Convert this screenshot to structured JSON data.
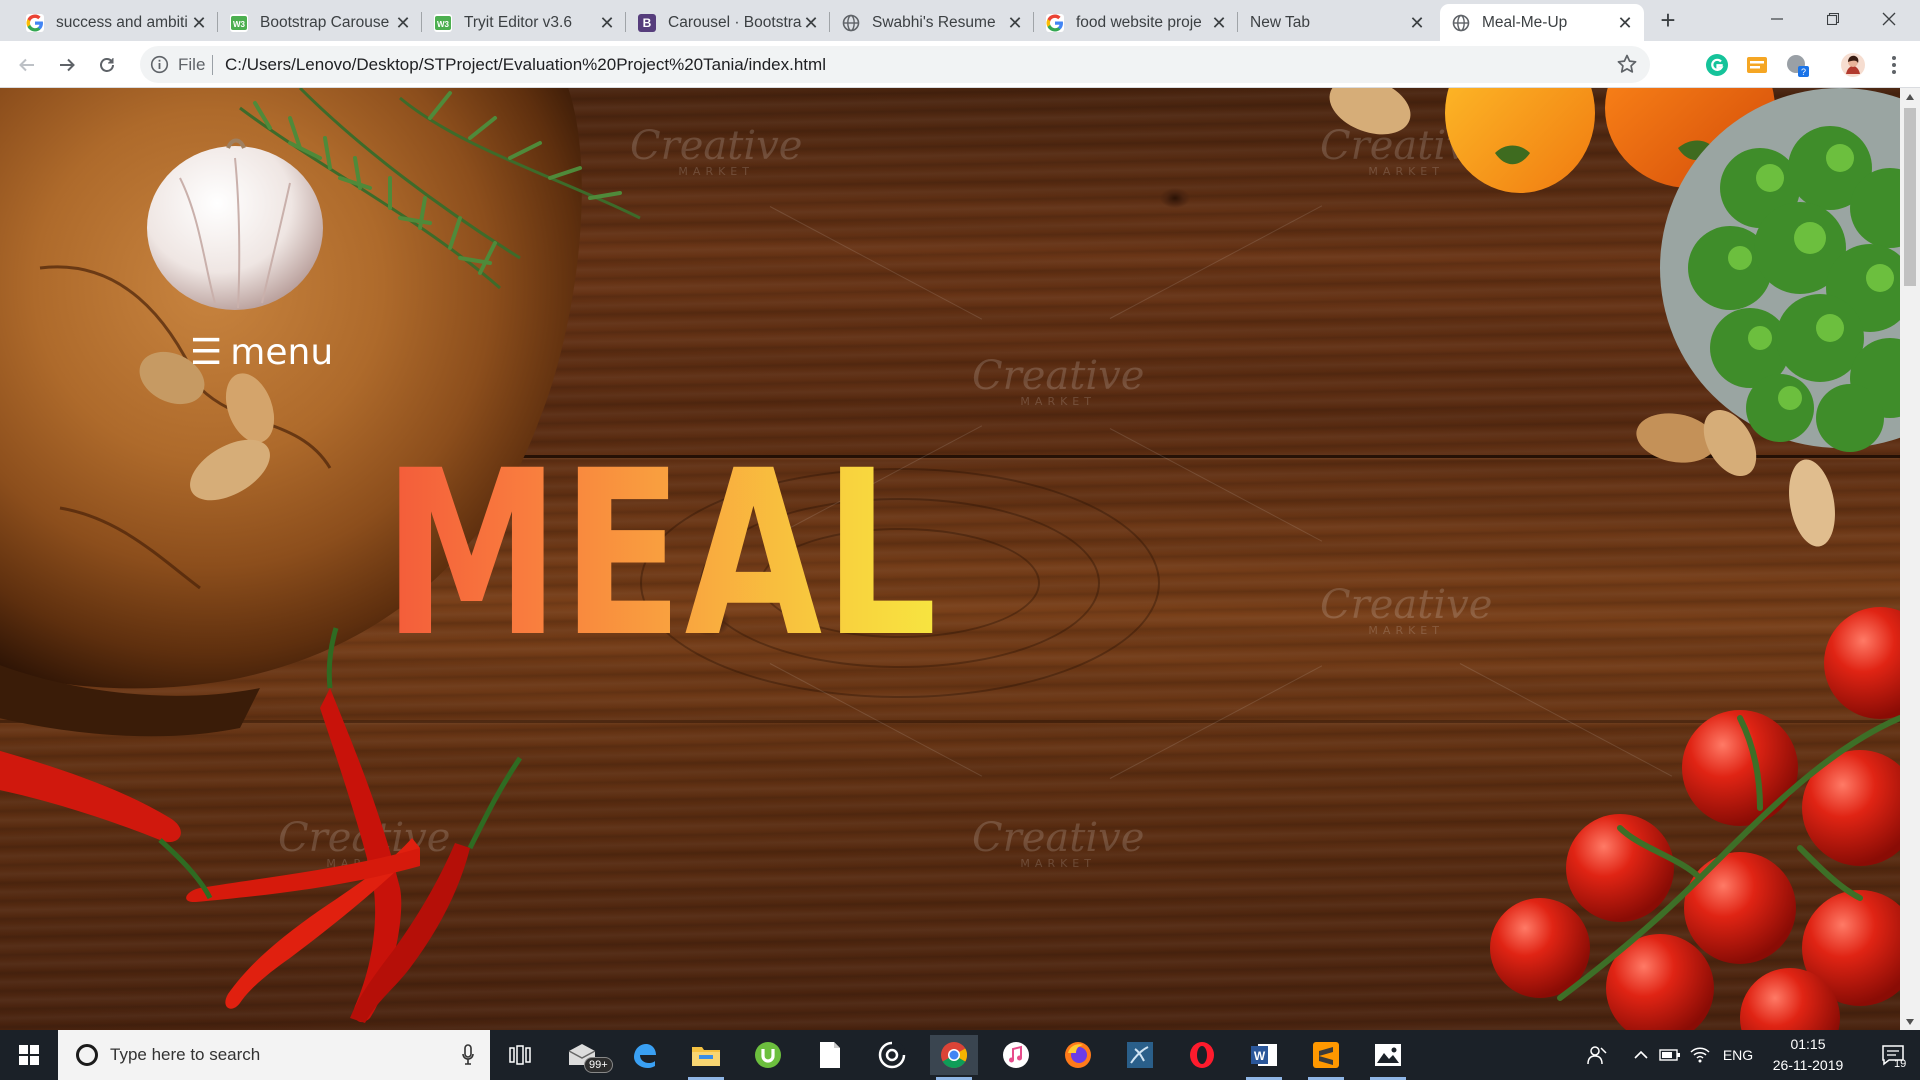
{
  "browser": {
    "tabs": [
      {
        "title": "success and ambiti",
        "favicon": "google-icon",
        "active": false
      },
      {
        "title": "Bootstrap Carouse",
        "favicon": "w3-editor-icon",
        "active": false
      },
      {
        "title": "Tryit Editor v3.6",
        "favicon": "w3-editor-icon",
        "active": false
      },
      {
        "title": "Carousel · Bootstra",
        "favicon": "bootstrap-icon",
        "active": false
      },
      {
        "title": "Swabhi's Resume",
        "favicon": "globe-icon",
        "active": false
      },
      {
        "title": "food website proje",
        "favicon": "google-icon",
        "active": false
      },
      {
        "title": "New Tab",
        "favicon": "",
        "active": false
      },
      {
        "title": "Meal-Me-Up",
        "favicon": "globe-icon",
        "active": true
      }
    ],
    "address": {
      "scheme_label": "File",
      "url": "C:/Users/Lenovo/Desktop/STProject/Evaluation%20Project%20Tania/index.html"
    }
  },
  "page": {
    "menu_icon": "☰",
    "menu_label": "menu",
    "hero_title": "MEAL",
    "title_gradient": [
      "#f35a3a",
      "#f97b3e",
      "#f9a63f",
      "#f8d43e",
      "#f7e540"
    ],
    "watermark": "Creative",
    "watermark_sub": "MARKET"
  },
  "taskbar": {
    "search_placeholder": "Type here to search",
    "mail_badge": "99+",
    "language": "ENG",
    "time": "01:15",
    "date": "26-11-2019",
    "notification_count": "19",
    "pinned_apps": [
      "task-view-icon",
      "mail-icon",
      "edge-icon",
      "file-explorer-icon",
      "utorrent-icon",
      "file-icon",
      "media-icon",
      "chrome-icon",
      "itunes-icon",
      "firefox-icon",
      "mysql-workbench-icon",
      "opera-icon",
      "word-icon",
      "sublime-text-icon",
      "photos-icon"
    ]
  }
}
